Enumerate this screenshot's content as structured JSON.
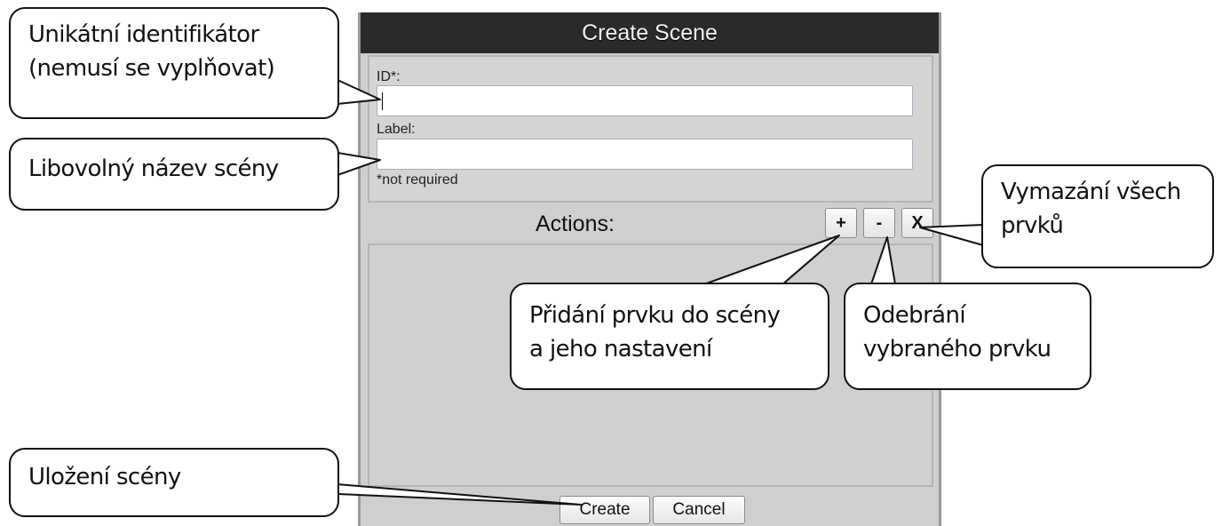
{
  "dialog": {
    "title": "Create Scene",
    "id_label": "ID*:",
    "id_value": "",
    "label_label": "Label:",
    "label_value": "",
    "note": "*not required",
    "actions_label": "Actions:",
    "add_label": "+",
    "remove_label": "-",
    "clear_label": "X",
    "create_label": "Create",
    "cancel_label": "Cancel"
  },
  "callouts": {
    "id_line1": "Unikátní identifikátor",
    "id_line2": "(nemusí se vyplňovat)",
    "label": "Libovolný název scény",
    "clear_line1": "Vymazání všech",
    "clear_line2": "prvků",
    "add_line1": "Přidání prvku do scény",
    "add_line2": "a jeho nastavení",
    "remove_line1": "Odebrání",
    "remove_line2": "vybraného prvku",
    "save": "Uložení scény"
  }
}
